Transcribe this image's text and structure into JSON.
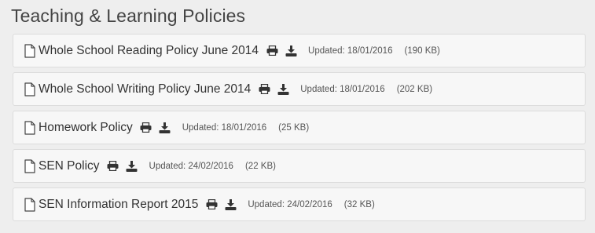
{
  "section": {
    "title": "Teaching & Learning Policies"
  },
  "icons": {
    "file": "file-icon",
    "print": "print-icon",
    "download": "download-icon"
  },
  "documents": [
    {
      "name": "Whole School Reading Policy June 2014",
      "updated": "Updated: 18/01/2016",
      "size": "(190 KB)"
    },
    {
      "name": "Whole School Writing Policy June 2014",
      "updated": "Updated: 18/01/2016",
      "size": "(202 KB)"
    },
    {
      "name": "Homework Policy",
      "updated": "Updated: 18/01/2016",
      "size": "(25 KB)"
    },
    {
      "name": "SEN Policy",
      "updated": "Updated: 24/02/2016",
      "size": "(22 KB)"
    },
    {
      "name": "SEN Information Report 2015",
      "updated": "Updated: 24/02/2016",
      "size": "(32 KB)"
    }
  ]
}
